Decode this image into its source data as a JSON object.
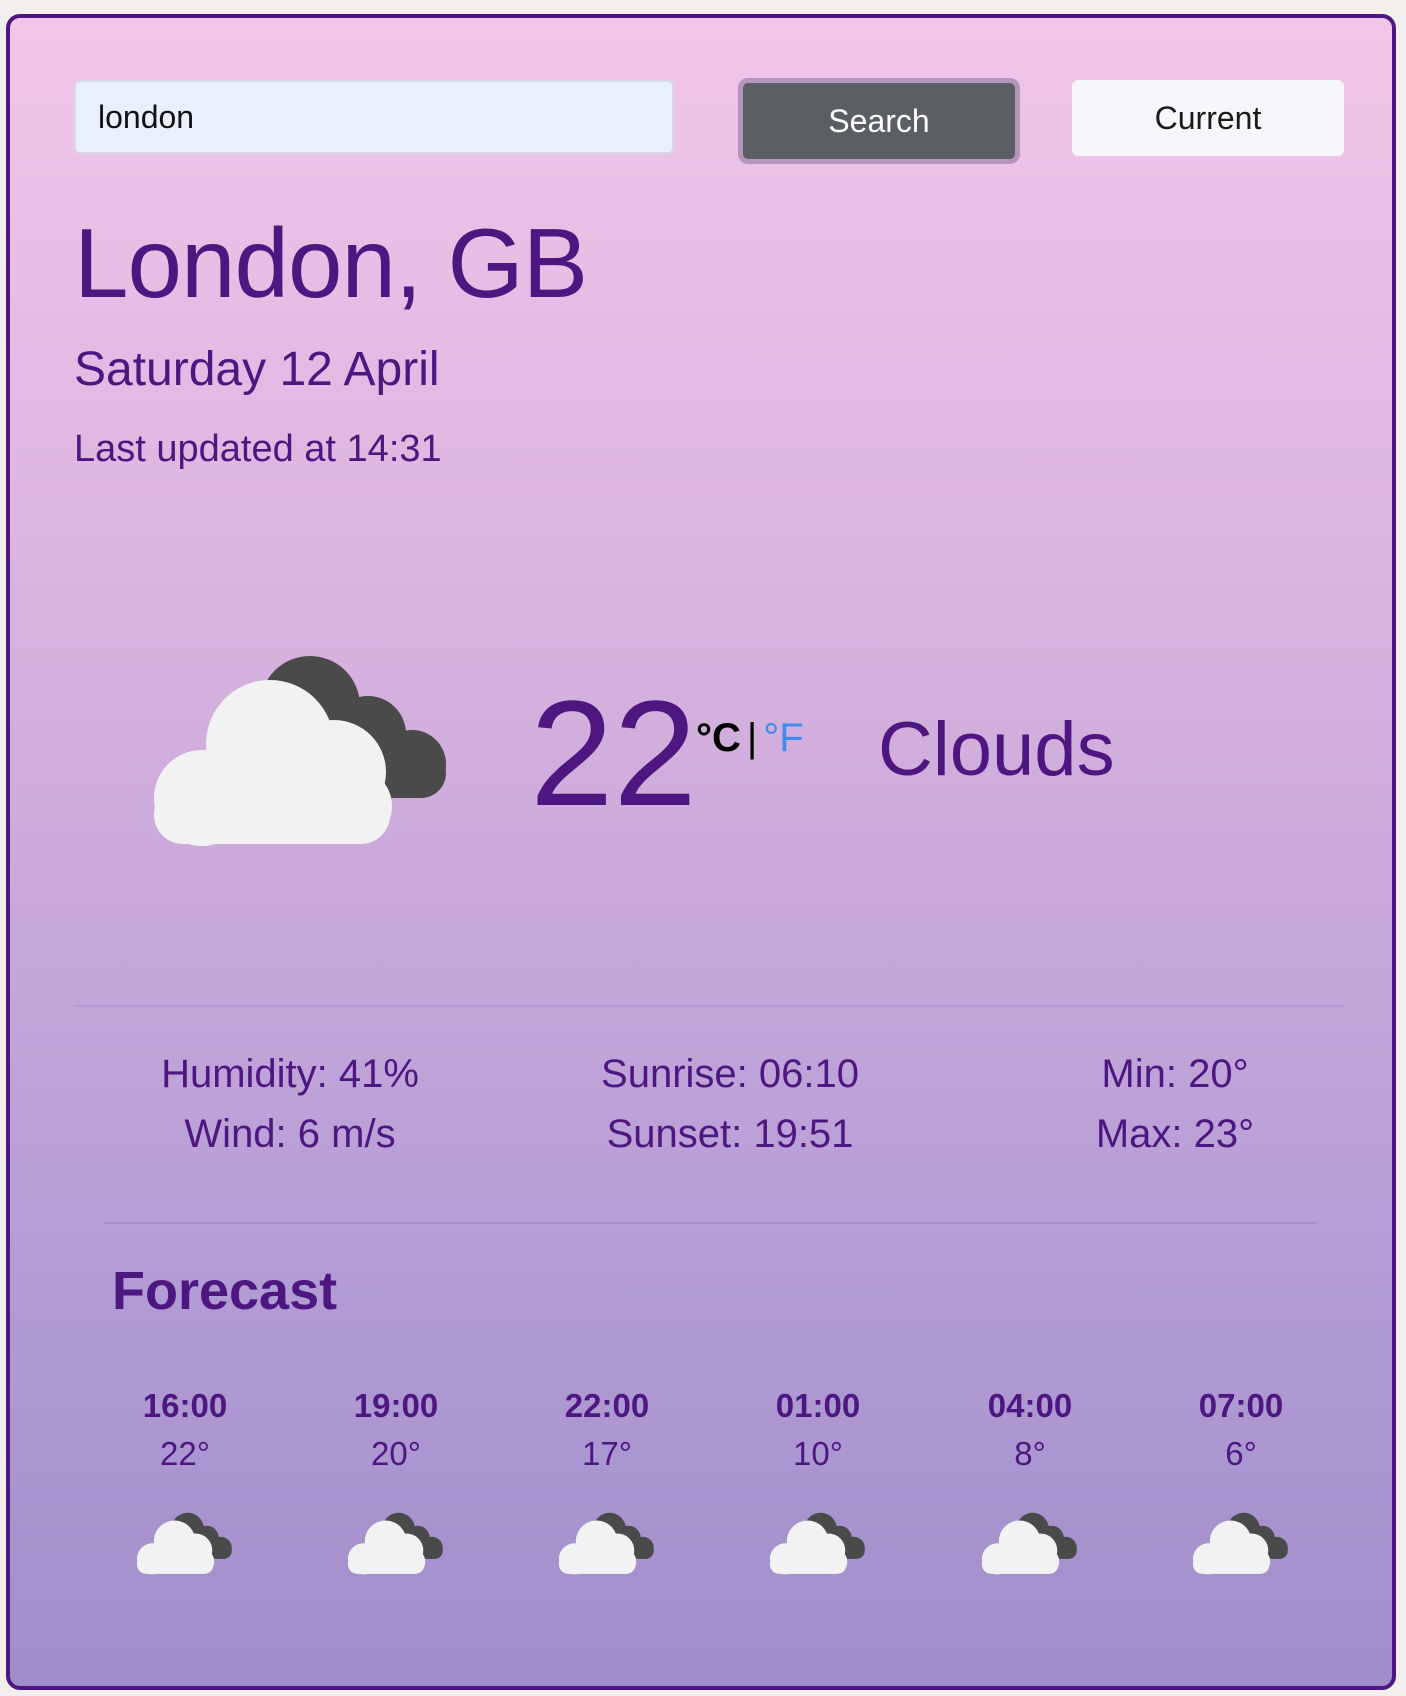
{
  "search": {
    "value": "london",
    "button_label": "Search",
    "current_label": "Current"
  },
  "location": {
    "city": "London, GB",
    "date": "Saturday 12 April",
    "updated": "Last updated at 14:31"
  },
  "current": {
    "temperature": "22",
    "unit_c": "°C",
    "unit_sep": "|",
    "unit_f": "°F",
    "condition": "Clouds",
    "icon": "clouds-icon"
  },
  "stats": {
    "humidity": "Humidity: 41%",
    "wind": "Wind: 6 m/s",
    "sunrise": "Sunrise: 06:10",
    "sunset": "Sunset: 19:51",
    "min": "Min: 20°",
    "max": "Max: 23°"
  },
  "forecast": {
    "title": "Forecast",
    "items": [
      {
        "time": "16:00",
        "temp": "22°",
        "icon": "clouds-icon"
      },
      {
        "time": "19:00",
        "temp": "20°",
        "icon": "clouds-icon"
      },
      {
        "time": "22:00",
        "temp": "17°",
        "icon": "clouds-icon"
      },
      {
        "time": "01:00",
        "temp": "10°",
        "icon": "clouds-icon"
      },
      {
        "time": "04:00",
        "temp": "8°",
        "icon": "clouds-icon"
      },
      {
        "time": "07:00",
        "temp": "6°",
        "icon": "clouds-icon"
      }
    ]
  },
  "colors": {
    "accent": "#4e1680",
    "fahrenheit_link": "#3f8bf2",
    "search_button": "#5b5e62",
    "input_background": "#e8f0fe",
    "cloud_white": "#f2f2f2",
    "cloud_dark": "#4a4a4a"
  }
}
